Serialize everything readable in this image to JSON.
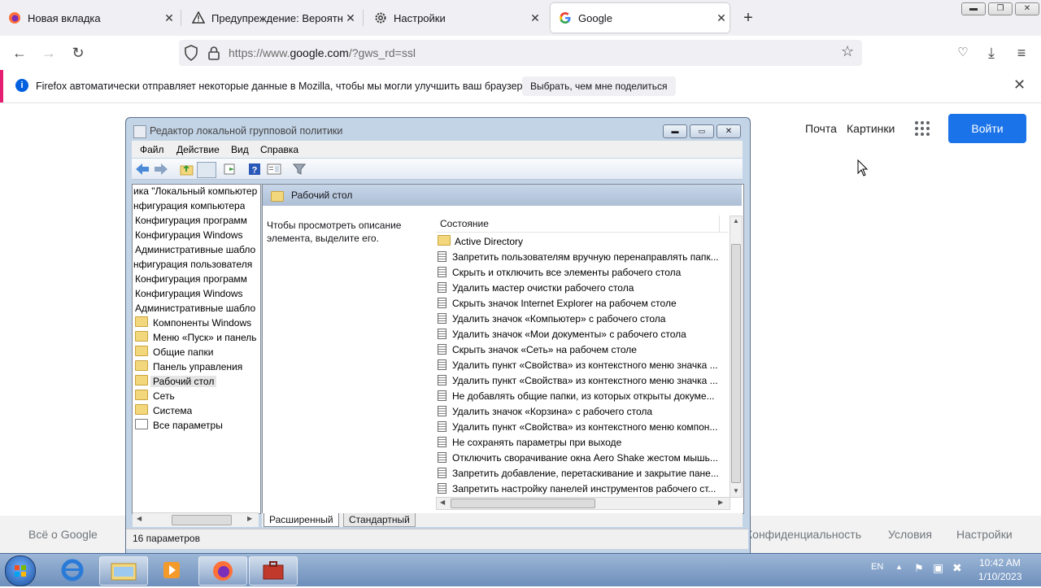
{
  "browser": {
    "tabs": [
      {
        "title": "Новая вкладка",
        "icon": "firefox-icon",
        "active": false
      },
      {
        "title": "Предупреждение: Вероятная у",
        "icon": "warning-icon",
        "active": false
      },
      {
        "title": "Настройки",
        "icon": "gear-icon",
        "active": false
      },
      {
        "title": "Google",
        "icon": "google-icon",
        "active": true
      }
    ],
    "new_tab": "+",
    "url_prefix": "https://www.",
    "url_domain": "google.com",
    "url_suffix": "/?gws_rd=ssl",
    "window_controls": [
      "minimize",
      "restore",
      "close"
    ]
  },
  "notification": {
    "text": "Firefox автоматически отправляет некоторые данные в Mozilla, чтобы мы могли улучшить ваш браузер.",
    "button": "Выбрать, чем мне поделиться"
  },
  "google": {
    "mail": "Почта",
    "images": "Картинки",
    "signin": "Войти",
    "accent": "#1a73e8",
    "footer_left": "Всё о Google",
    "footer_right": [
      "Конфиденциальность",
      "Условия",
      "Настройки"
    ]
  },
  "gpedit": {
    "title": "Редактор локальной групповой политики",
    "menu": [
      "Файл",
      "Действие",
      "Вид",
      "Справка"
    ],
    "tree": [
      {
        "label": "ика \"Локальный компьютер",
        "icon": "none"
      },
      {
        "label": "нфигурация компьютера",
        "icon": "none"
      },
      {
        "label": "Конфигурация программ",
        "icon": "none"
      },
      {
        "label": "Конфигурация Windows",
        "icon": "none"
      },
      {
        "label": "Административные шабло",
        "icon": "none"
      },
      {
        "label": "нфигурация пользователя",
        "icon": "none"
      },
      {
        "label": "Конфигурация программ",
        "icon": "none"
      },
      {
        "label": "Конфигурация Windows",
        "icon": "none"
      },
      {
        "label": "Административные шабло",
        "icon": "none"
      },
      {
        "label": "Компоненты Windows",
        "icon": "folder"
      },
      {
        "label": "Меню «Пуск» и панель",
        "icon": "folder"
      },
      {
        "label": "Общие папки",
        "icon": "folder"
      },
      {
        "label": "Панель управления",
        "icon": "folder"
      },
      {
        "label": "Рабочий стол",
        "icon": "folder"
      },
      {
        "label": "Сеть",
        "icon": "folder"
      },
      {
        "label": "Система",
        "icon": "folder"
      },
      {
        "label": "Все параметры",
        "icon": "settings-folder"
      }
    ],
    "selected_folder": "Рабочий стол",
    "description": "Чтобы просмотреть описание элемента, выделите его.",
    "column_header": "Состояние",
    "items": [
      {
        "label": "Active Directory",
        "icon": "folder"
      },
      {
        "label": "Запретить пользователям вручную перенаправлять папк...",
        "icon": "policy"
      },
      {
        "label": "Скрыть и отключить все элементы рабочего стола",
        "icon": "policy"
      },
      {
        "label": "Удалить мастер очистки рабочего стола",
        "icon": "policy"
      },
      {
        "label": "Скрыть значок Internet Explorer на рабочем столе",
        "icon": "policy"
      },
      {
        "label": "Удалить значок «Компьютер» с рабочего стола",
        "icon": "policy"
      },
      {
        "label": "Удалить значок «Мои документы» с рабочего стола",
        "icon": "policy"
      },
      {
        "label": "Скрыть значок «Сеть» на рабочем столе",
        "icon": "policy"
      },
      {
        "label": "Удалить пункт «Свойства» из контекстного меню значка ...",
        "icon": "policy"
      },
      {
        "label": "Удалить пункт «Свойства» из контекстного меню значка ...",
        "icon": "policy"
      },
      {
        "label": "Не добавлять общие папки, из которых открыты докуме...",
        "icon": "policy"
      },
      {
        "label": "Удалить значок «Корзина» с рабочего стола",
        "icon": "policy"
      },
      {
        "label": "Удалить пункт «Свойства» из контекстного меню компон...",
        "icon": "policy"
      },
      {
        "label": "Не сохранять параметры при выходе",
        "icon": "policy"
      },
      {
        "label": "Отключить сворачивание окна Aero Shake жестом мышь...",
        "icon": "policy"
      },
      {
        "label": "Запретить добавление, перетаскивание и закрытие пане...",
        "icon": "policy"
      },
      {
        "label": "Запретить настройку панелей инструментов рабочего ст...",
        "icon": "policy"
      }
    ],
    "tabs": [
      "Расширенный",
      "Стандартный"
    ],
    "status": "16 параметров"
  },
  "taskbar": {
    "lang": "EN",
    "time": "10:42 AM",
    "date": "1/10/2023",
    "apps": [
      "start-orb-icon",
      "internet-explorer-icon",
      "explorer-folder-icon",
      "media-player-icon",
      "firefox-icon",
      "gpedit-icon"
    ]
  }
}
